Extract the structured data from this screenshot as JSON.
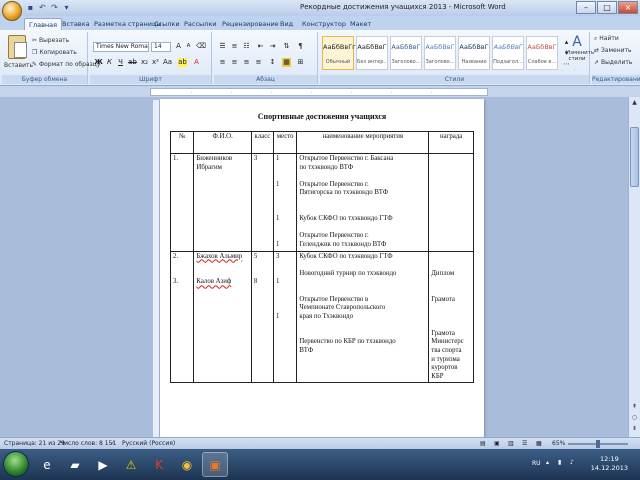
{
  "window": {
    "title": "Рекордные достижения учащихся 2013 - Microsoft Word"
  },
  "ribbon_tabs": [
    {
      "label": "Главная",
      "active": true
    },
    {
      "label": "Вставка",
      "active": false
    },
    {
      "label": "Разметка страницы",
      "active": false
    },
    {
      "label": "Ссылки",
      "active": false
    },
    {
      "label": "Рассылки",
      "active": false
    },
    {
      "label": "Рецензирование",
      "active": false
    },
    {
      "label": "Вид",
      "active": false
    },
    {
      "label": "Конструктор",
      "active": false
    },
    {
      "label": "Макет",
      "active": false
    }
  ],
  "clipboard": {
    "paste_label": "Вставить",
    "cut_label": "Вырезать",
    "copy_label": "Копировать",
    "format_painter_label": "Формат по образцу",
    "group_label": "Буфер обмена"
  },
  "font": {
    "font_name": "Times New Roman",
    "font_size": "14",
    "group_label": "Шрифт"
  },
  "paragraph": {
    "group_label": "Абзац"
  },
  "styles": {
    "items": [
      {
        "sample": "АаБбВвГг",
        "name": "Обычный"
      },
      {
        "sample": "АаБбВвГ",
        "name": "Без интер..."
      },
      {
        "sample": "АаБбВвГ",
        "name": "Заголово..."
      },
      {
        "sample": "АаБбВвГ",
        "name": "Заголово..."
      },
      {
        "sample": "АаБбВвГ",
        "name": "Название"
      },
      {
        "sample": "АаБбВвГ",
        "name": "Подзагол..."
      },
      {
        "sample": "АаБбВвГ",
        "name": "Слабое в..."
      }
    ],
    "change_styles_label": "Изменить стили",
    "group_label": "Стили"
  },
  "editing": {
    "find_label": "Найти",
    "replace_label": "Заменить",
    "select_label": "Выделить",
    "group_label": "Редактирование"
  },
  "document": {
    "title": "Спортивные достижения учащихся",
    "headers": [
      "№",
      "Ф.И.О.",
      "класс",
      "место",
      "наименование мероприятия",
      "награда"
    ],
    "rows": [
      {
        "num": "1.",
        "name": "Биженников Ибрагим",
        "class": "3",
        "places": [
          "1",
          "",
          "",
          "",
          "1",
          "",
          "",
          "",
          "1",
          "",
          "",
          "1"
        ],
        "events": [
          "Открытое Первенство г. Баксана",
          "по тхэквондо ВТФ",
          "",
          "Открытое Первенство г.",
          "Пятигорска по тхэквондо ВТФ",
          "",
          "",
          "Кубок СКФО по тхэквондо ГТФ",
          "",
          "Открытое Первенство г.",
          "Геленджик по тхэквондо ВТФ"
        ],
        "award": []
      },
      {
        "num": "2.",
        "name": "Бжахов Альмир",
        "class": "5",
        "places": [
          "3"
        ],
        "events": [
          "Кубок СКФО по тхэквондо ГТФ"
        ],
        "award": []
      },
      {
        "num": "3.",
        "name": "Калов Азиф",
        "class": "8",
        "places": [
          "1",
          "",
          "",
          "",
          "1"
        ],
        "events": [
          "Новогодний турнир по тхэквондо",
          "",
          "",
          "Открытое Первенство в",
          "Чемпионате Ставропольского",
          "края по Тхэквондо",
          "",
          "",
          "Первенство по КБР по тхэквондо",
          "ВТФ"
        ],
        "award": [
          "Диплом",
          "",
          "",
          "Грамота",
          "",
          "",
          "",
          "Грамота",
          "Министерс",
          "тва спорта",
          "и туризма",
          "курортов",
          "КБР"
        ]
      }
    ]
  },
  "statusbar": {
    "page": "Страница: 21 из 29",
    "words": "Число слов: 8 151",
    "language": "Русский (Россия)",
    "zoom": "65%"
  },
  "taskbar": {
    "language": "RU",
    "time": "12:19",
    "date": "14.12.2013"
  },
  "colors": {
    "ribbon_accent": "#15396b",
    "spell_error": "#d02020"
  }
}
